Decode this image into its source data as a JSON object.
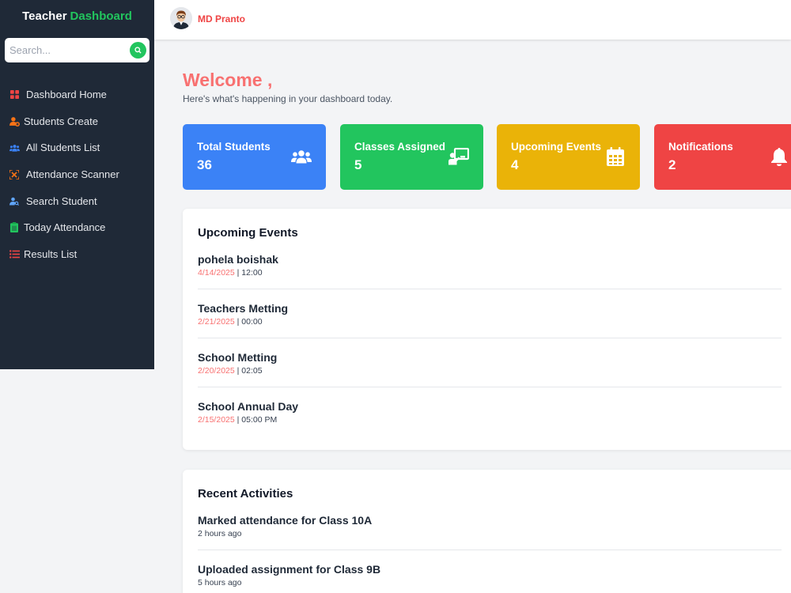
{
  "sidebar": {
    "brand_first": "Teacher",
    "brand_second": "Dashboard",
    "search_placeholder": "Search...",
    "items": [
      {
        "label": "Dashboard Home",
        "icon": "dashboard-icon"
      },
      {
        "label": "Students Create",
        "icon": "user-plus-icon"
      },
      {
        "label": "All Students List",
        "icon": "users-icon"
      },
      {
        "label": "Attendance Scanner",
        "icon": "scanner-icon"
      },
      {
        "label": "Search Student",
        "icon": "user-search-icon"
      },
      {
        "label": "Today Attendance",
        "icon": "clipboard-icon"
      },
      {
        "label": "Results List",
        "icon": "list-icon"
      }
    ]
  },
  "header": {
    "user_name": "MD Pranto"
  },
  "main": {
    "welcome": "Welcome ,",
    "subtitle": "Here's what's happening in your dashboard today.",
    "cards": [
      {
        "label": "Total Students",
        "value": "36",
        "color": "#3b82f6",
        "icon": "users-icon"
      },
      {
        "label": "Classes Assigned",
        "value": "5",
        "color": "#22c55e",
        "icon": "chalkboard-teacher-icon"
      },
      {
        "label": "Upcoming Events",
        "value": "4",
        "color": "#eab308",
        "icon": "calendar-icon"
      },
      {
        "label": "Notifications",
        "value": "2",
        "color": "#ef4444",
        "icon": "bell-icon"
      }
    ],
    "events": {
      "title": "Upcoming Events",
      "items": [
        {
          "title": "pohela boishak",
          "date": "4/14/2025",
          "time": "12:00"
        },
        {
          "title": "Teachers Metting",
          "date": "2/21/2025",
          "time": "00:00"
        },
        {
          "title": "School Metting",
          "date": "2/20/2025",
          "time": "02:05"
        },
        {
          "title": "School Annual Day",
          "date": "2/15/2025",
          "time": "05:00 PM"
        }
      ]
    },
    "activities": {
      "title": "Recent Activities",
      "items": [
        {
          "title": "Marked attendance for Class 10A",
          "time": "2 hours ago"
        },
        {
          "title": "Uploaded assignment for Class 9B",
          "time": "5 hours ago"
        }
      ]
    }
  }
}
